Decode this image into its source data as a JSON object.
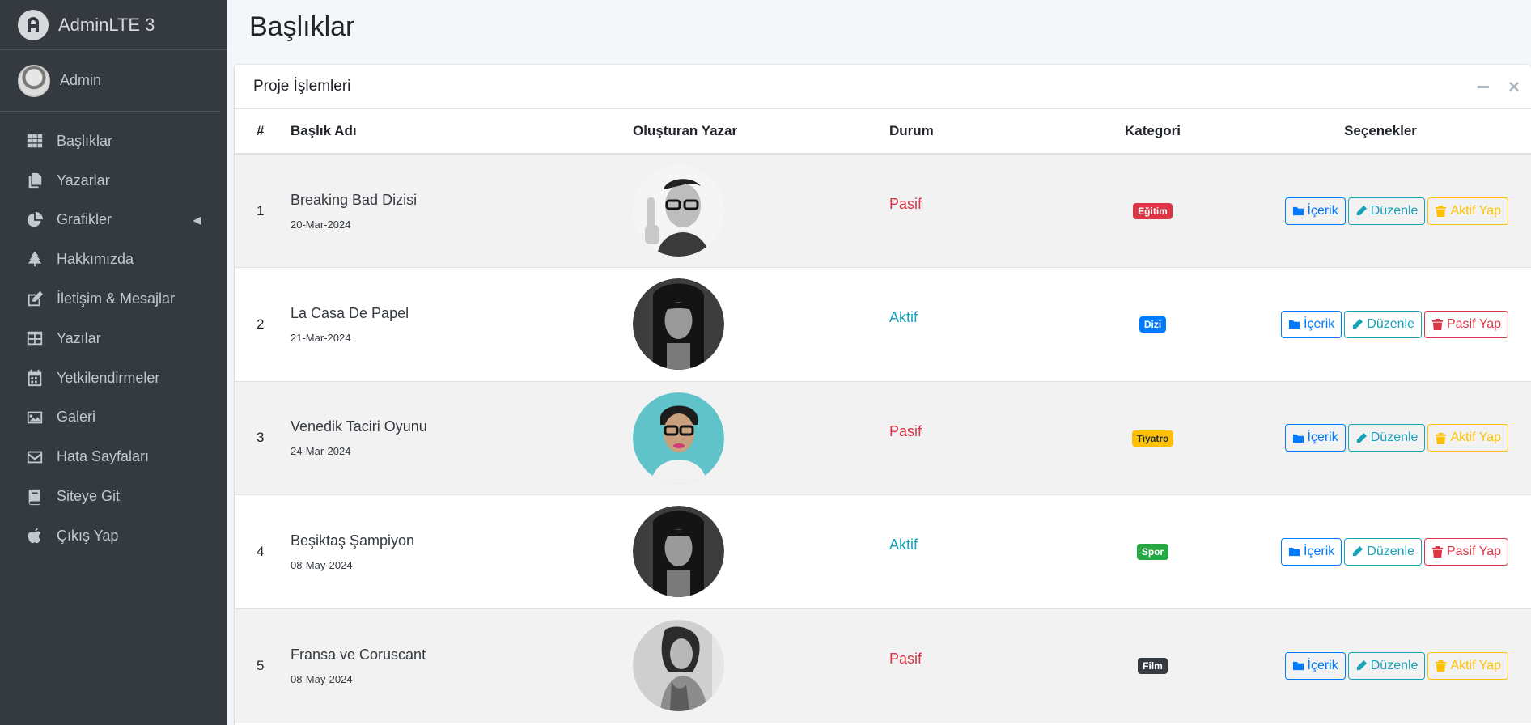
{
  "brand": {
    "name": "AdminLTE 3"
  },
  "user": {
    "name": "Admin"
  },
  "sidebar": {
    "items": [
      {
        "label": "Başlıklar",
        "icon": "grid-icon"
      },
      {
        "label": "Yazarlar",
        "icon": "copy-icon"
      },
      {
        "label": "Grafikler",
        "icon": "pie-chart-icon",
        "has_caret": true
      },
      {
        "label": "Hakkımızda",
        "icon": "tree-icon"
      },
      {
        "label": "İletişim & Mesajlar",
        "icon": "edit-icon"
      },
      {
        "label": "Yazılar",
        "icon": "table-icon"
      },
      {
        "label": "Yetkilendirmeler",
        "icon": "calendar-icon"
      },
      {
        "label": "Galeri",
        "icon": "image-icon"
      },
      {
        "label": "Hata Sayfaları",
        "icon": "envelope-icon"
      },
      {
        "label": "Siteye Git",
        "icon": "book-icon"
      },
      {
        "label": "Çıkış Yap",
        "icon": "apple-icon"
      }
    ]
  },
  "page": {
    "title": "Başlıklar"
  },
  "card": {
    "title": "Proje İşlemleri"
  },
  "table": {
    "headers": {
      "num": "#",
      "title": "Başlık Adı",
      "author": "Oluşturan Yazar",
      "status": "Durum",
      "category": "Kategori",
      "options": "Seçenekler"
    },
    "rows": [
      {
        "num": "1",
        "title": "Breaking Bad Dizisi",
        "date": "20-Mar-2024",
        "status": "Pasif",
        "category": "Eğitim",
        "toggle": "Aktif Yap"
      },
      {
        "num": "2",
        "title": "La Casa De Papel",
        "date": "21-Mar-2024",
        "status": "Aktif",
        "category": "Dizi",
        "toggle": "Pasif Yap"
      },
      {
        "num": "3",
        "title": "Venedik Taciri Oyunu",
        "date": "24-Mar-2024",
        "status": "Pasif",
        "category": "Tiyatro",
        "toggle": "Aktif Yap"
      },
      {
        "num": "4",
        "title": "Beşiktaş Şampiyon",
        "date": "08-May-2024",
        "status": "Aktif",
        "category": "Spor",
        "toggle": "Pasif Yap"
      },
      {
        "num": "5",
        "title": "Fransa ve Coruscant",
        "date": "08-May-2024",
        "status": "Pasif",
        "category": "Film",
        "toggle": "Aktif Yap"
      }
    ],
    "buttons": {
      "content": "İçerik",
      "edit": "Düzenle"
    }
  },
  "colors": {
    "sidebar_bg": "#343a40",
    "badge_egitim": "#dc3545",
    "badge_dizi": "#007bff",
    "badge_tiyatro": "#ffc107",
    "badge_spor": "#28a745",
    "badge_film": "#343a40"
  }
}
